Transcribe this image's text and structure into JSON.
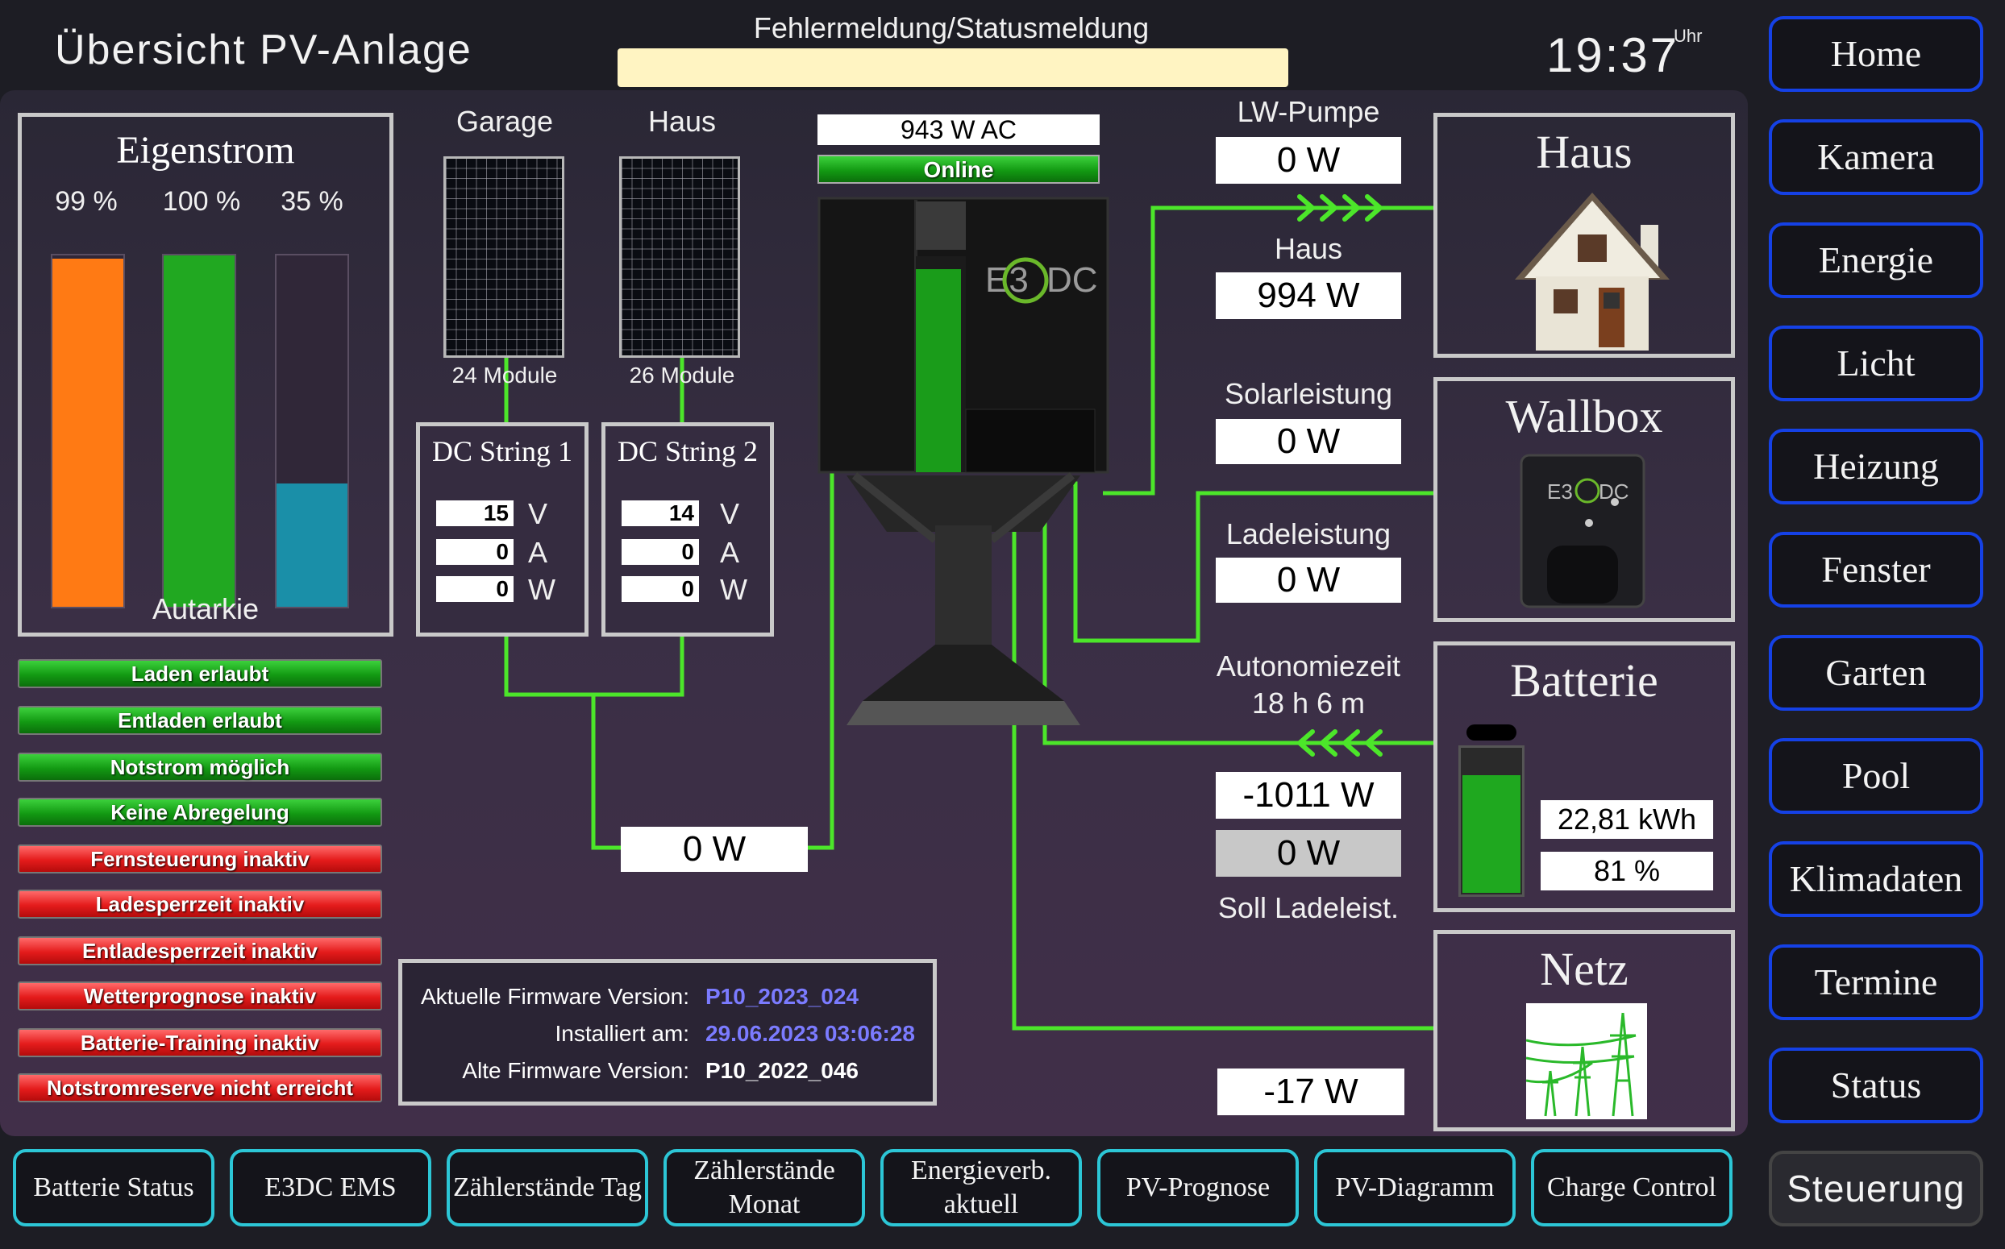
{
  "header": {
    "title": "Übersicht PV-Anlage",
    "status_label": "Fehlermeldung/Statusmeldung",
    "status_message": "",
    "clock": "19:37",
    "clock_unit": "Uhr"
  },
  "eigenstrom": {
    "title": "Eigenstrom",
    "bars": [
      {
        "label": "99 %",
        "value": 99,
        "color": "#ff7a14"
      },
      {
        "label": "100 %",
        "value": 100,
        "color": "#21a821"
      },
      {
        "label": "35 %",
        "value": 35,
        "color": "#1a8fa8"
      }
    ],
    "caption": "Autarkie"
  },
  "flags": [
    {
      "label": "Laden erlaubt",
      "state": "ok"
    },
    {
      "label": "Entladen erlaubt",
      "state": "ok"
    },
    {
      "label": "Notstrom möglich",
      "state": "ok"
    },
    {
      "label": "Keine Abregelung",
      "state": "ok"
    },
    {
      "label": "Fernsteuerung inaktiv",
      "state": "bad"
    },
    {
      "label": "Ladesperrzeit inaktiv",
      "state": "bad"
    },
    {
      "label": "Entladesperrzeit inaktiv",
      "state": "bad"
    },
    {
      "label": "Wetterprognose inaktiv",
      "state": "bad"
    },
    {
      "label": "Batterie-Training inaktiv",
      "state": "bad"
    },
    {
      "label": "Notstromreserve nicht erreicht",
      "state": "bad"
    }
  ],
  "pv": {
    "garage": {
      "label": "Garage",
      "modules": "24 Module"
    },
    "haus": {
      "label": "Haus",
      "modules": "26 Module"
    },
    "string1": {
      "title": "DC String 1",
      "volt": "15",
      "amp": "0",
      "watt": "0"
    },
    "string2": {
      "title": "DC String 2",
      "volt": "14",
      "amp": "0",
      "watt": "0"
    },
    "units": {
      "v": "V",
      "a": "A",
      "w": "W"
    },
    "total": "0 W"
  },
  "inverter": {
    "ac_power": "943 W AC",
    "online": "Online",
    "battery_level_pct": 75
  },
  "firmware": {
    "current_label": "Aktuelle Firmware Version:",
    "current_value": "P10_2023_024",
    "installed_label": "Installiert am:",
    "installed_value": "29.06.2023 03:06:28",
    "old_label": "Alte Firmware Version:",
    "old_value": "P10_2022_046"
  },
  "values": {
    "lw_label": "LW-Pumpe",
    "lw_value": "0 W",
    "haus_label": "Haus",
    "haus_value": "994 W",
    "solar_label": "Solarleistung",
    "solar_value": "0 W",
    "lade_label": "Ladeleistung",
    "lade_value": "0 W",
    "auto_label": "Autonomiezeit",
    "auto_value": "18 h 6 m",
    "batt_power": "-1011 W",
    "soll_value": "0 W",
    "soll_label": "Soll Ladeleist.",
    "netz_value": "-17 W"
  },
  "rightboxes": {
    "haus": "Haus",
    "wallbox": "Wallbox",
    "batterie": "Batterie",
    "batterie_kwh": "22,81 kWh",
    "batterie_pct": "81 %",
    "batterie_level_pct": 81,
    "netz": "Netz"
  },
  "nav": [
    "Home",
    "Kamera",
    "Energie",
    "Licht",
    "Heizung",
    "Fenster",
    "Garten",
    "Pool",
    "Klimadaten",
    "Termine",
    "Status",
    "Steuerung"
  ],
  "bottom": [
    "Batterie Status",
    "E3DC EMS",
    "Zählerstände Tag",
    "Zählerstände Monat",
    "Energieverb. aktuell",
    "PV-Prognose",
    "PV-Diagramm",
    "Charge Control"
  ],
  "colors": {
    "flow": "#4ce62a",
    "nav_border": "#1541e6",
    "bottom_border": "#2cc6d6"
  }
}
